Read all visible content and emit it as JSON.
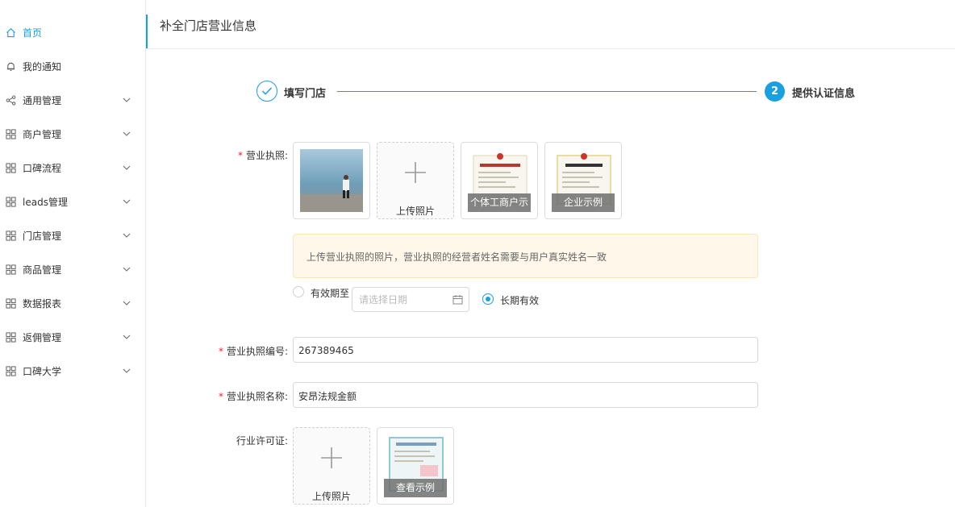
{
  "sidebar": {
    "items": [
      {
        "label": "首页",
        "icon": "home-icon",
        "active": true,
        "expandable": false
      },
      {
        "label": "我的通知",
        "icon": "bell-icon",
        "active": false,
        "expandable": false
      },
      {
        "label": "通用管理",
        "icon": "share-icon",
        "active": false,
        "expandable": true
      },
      {
        "label": "商户管理",
        "icon": "grid-icon",
        "active": false,
        "expandable": true
      },
      {
        "label": "口碑流程",
        "icon": "grid-icon",
        "active": false,
        "expandable": true
      },
      {
        "label": "leads管理",
        "icon": "grid-icon",
        "active": false,
        "expandable": true
      },
      {
        "label": "门店管理",
        "icon": "grid-icon",
        "active": false,
        "expandable": true
      },
      {
        "label": "商品管理",
        "icon": "grid-icon",
        "active": false,
        "expandable": true
      },
      {
        "label": "数据报表",
        "icon": "grid-icon",
        "active": false,
        "expandable": true
      },
      {
        "label": "返佣管理",
        "icon": "grid-icon",
        "active": false,
        "expandable": true
      },
      {
        "label": "口碑大学",
        "icon": "grid-icon",
        "active": false,
        "expandable": true
      }
    ]
  },
  "header": {
    "title": "补全门店营业信息"
  },
  "steps": [
    {
      "label": "填写门店",
      "status": "done"
    },
    {
      "number": "2",
      "label": "提供认证信息",
      "status": "active"
    }
  ],
  "form": {
    "license": {
      "label": "营业执照:",
      "required": true,
      "upload_caption": "上传照片",
      "example_individual": "个体工商户示",
      "example_company": "企业示例",
      "tip": "上传营业执照的照片，营业执照的经营者姓名需要与用户真实姓名一致"
    },
    "validity": {
      "option_until": "有效期至",
      "date_placeholder": "请选择日期",
      "option_forever": "长期有效",
      "selected": "长期有效"
    },
    "license_number": {
      "label": "营业执照编号:",
      "value": "267389465",
      "required": true
    },
    "license_name": {
      "label": "营业执照名称:",
      "value": "安昂法规金额",
      "required": true
    },
    "industry_permit": {
      "label": "行业许可证:",
      "upload_caption": "上传照片",
      "example_caption": "查看示例"
    }
  },
  "colors": {
    "accent": "#1a9fe0",
    "required": "#ee2233",
    "tip_bg": "#fff8ea"
  }
}
